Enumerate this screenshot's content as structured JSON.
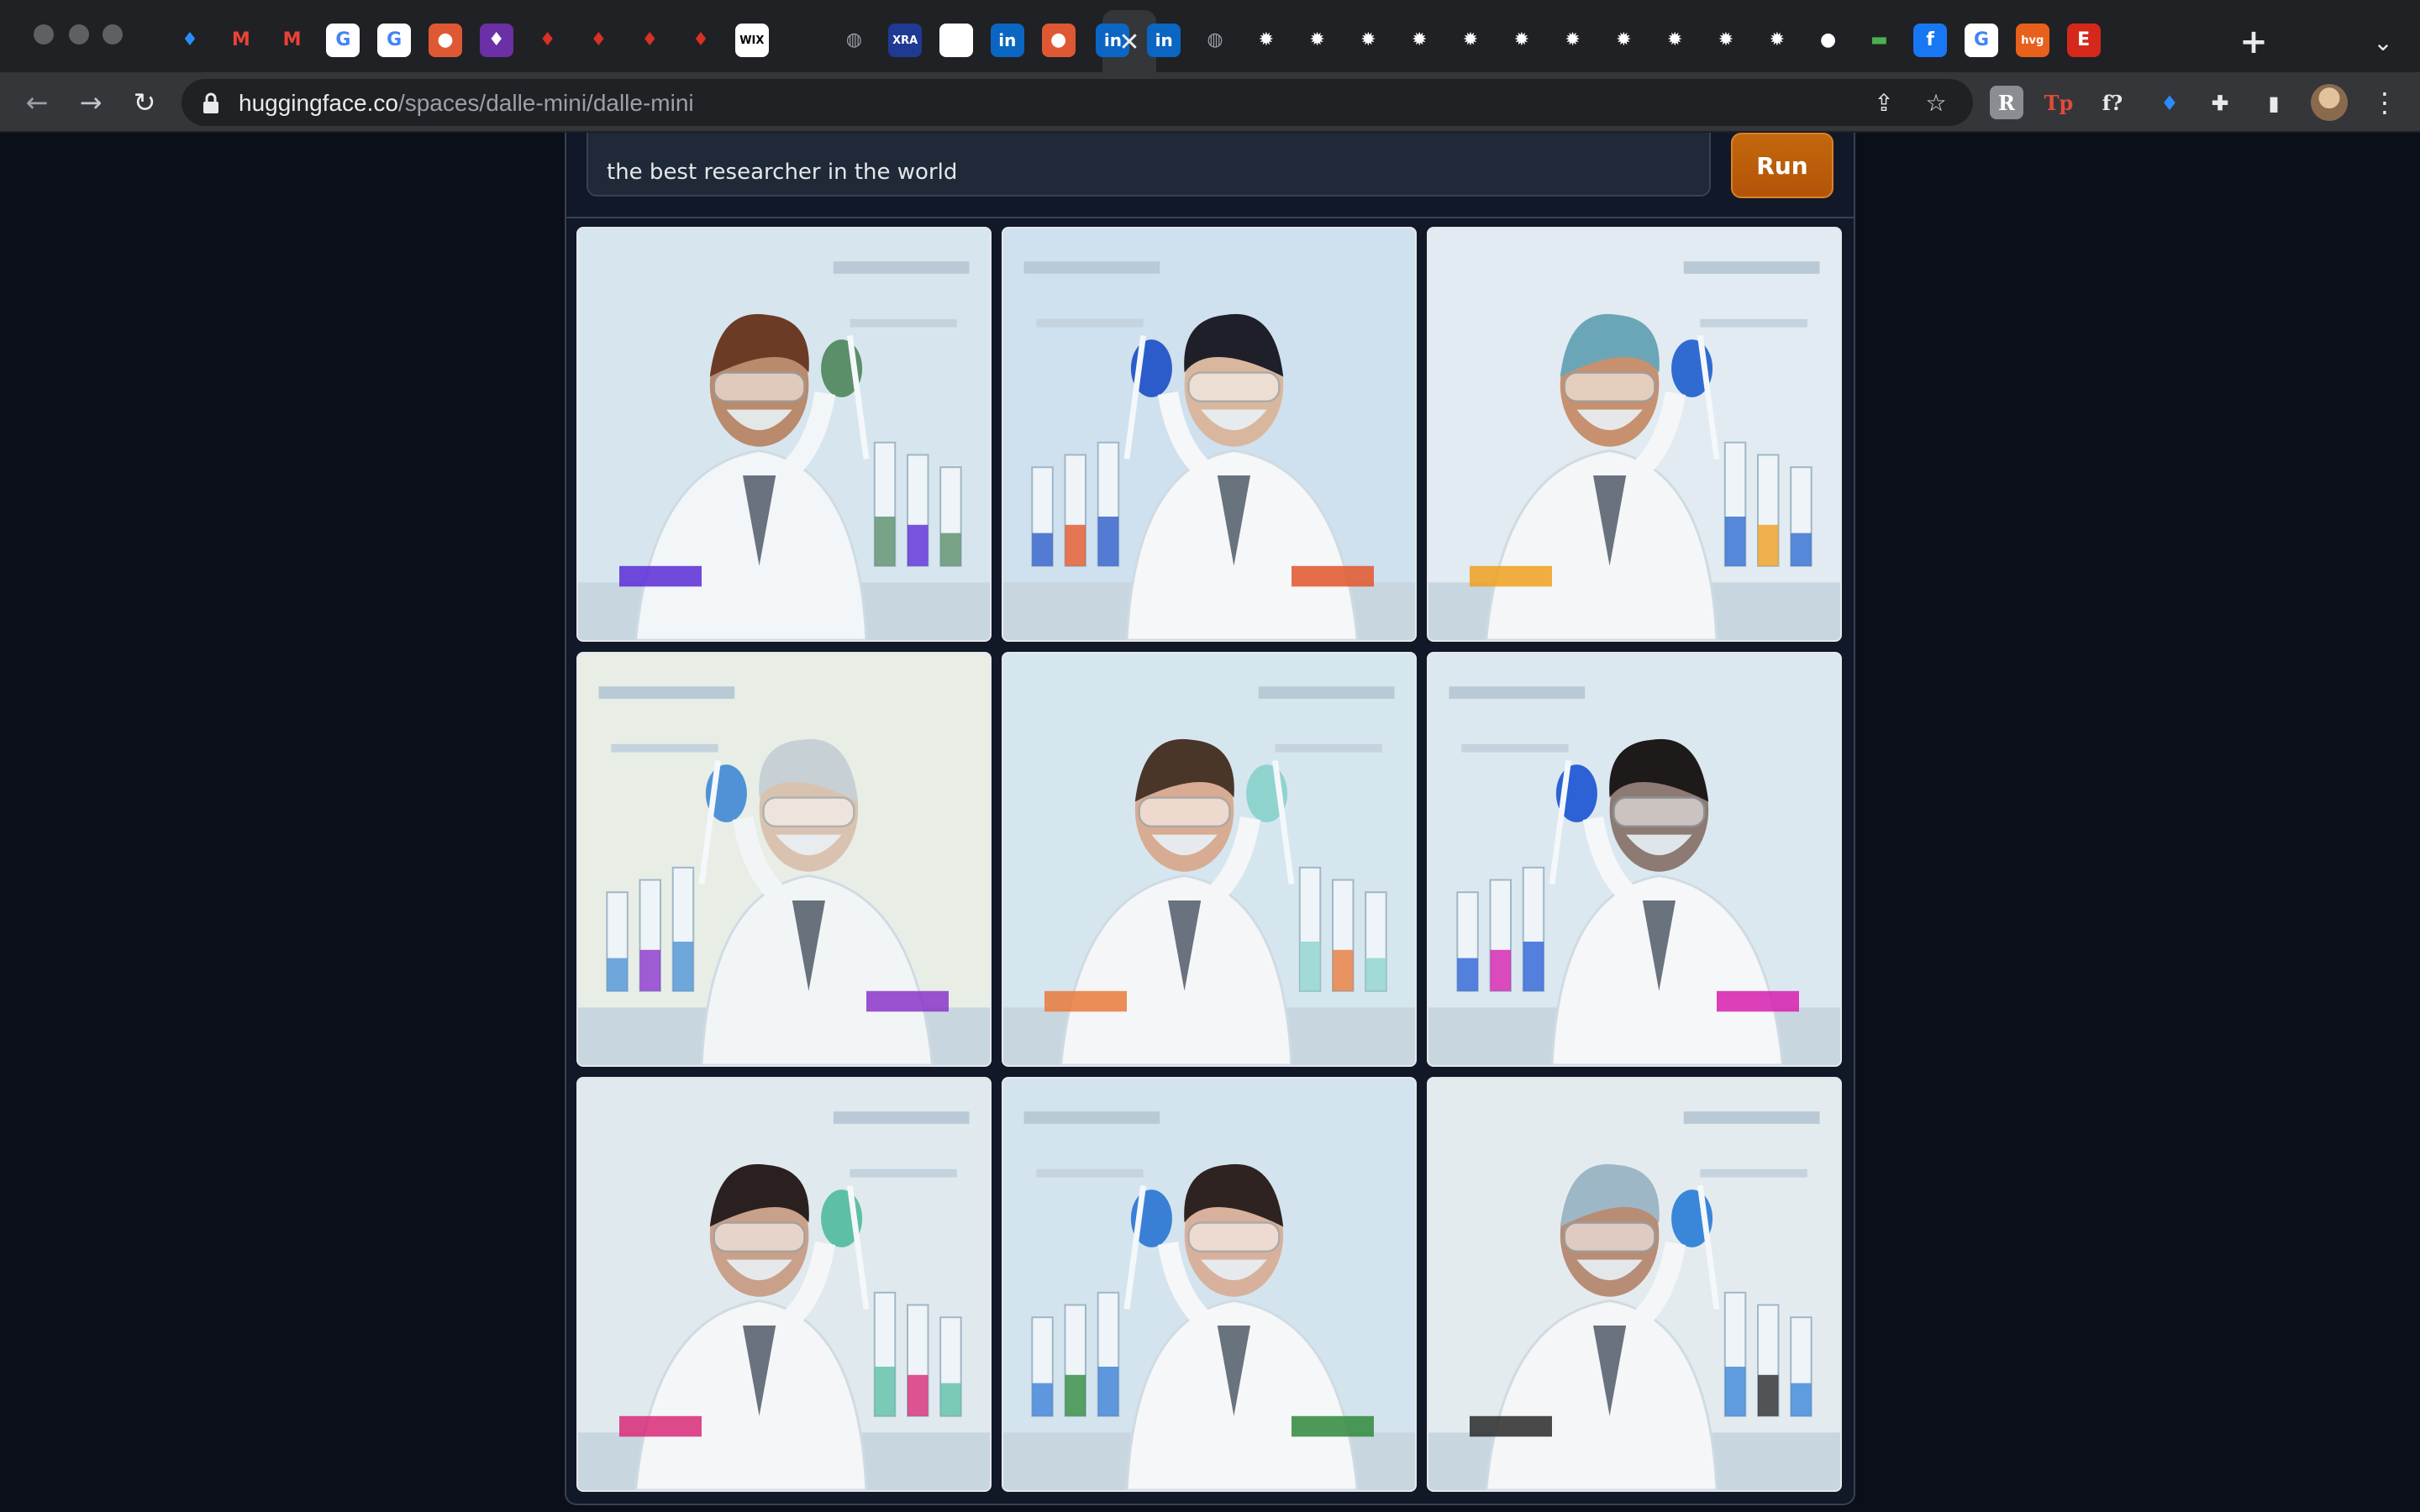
{
  "browser": {
    "url_host": "huggingface.co",
    "url_path": "/spaces/dalle-mini/dalle-mini",
    "tabs": [
      {
        "icon": "gem-icon",
        "glyph": "♦",
        "color": "#2b8cff",
        "bg": "transparent"
      },
      {
        "icon": "gmail-icon",
        "glyph": "M",
        "color": "#ea4335",
        "bg": "transparent"
      },
      {
        "icon": "gmail-icon",
        "glyph": "M",
        "color": "#ea4335",
        "bg": "transparent"
      },
      {
        "icon": "google-icon",
        "glyph": "G",
        "color": "#4285f4",
        "bg": "#ffffff"
      },
      {
        "icon": "google-icon",
        "glyph": "G",
        "color": "#4285f4",
        "bg": "#ffffff"
      },
      {
        "icon": "duckduckgo-icon",
        "glyph": "●",
        "color": "#ffffff",
        "bg": "#de5833"
      },
      {
        "icon": "bulb-icon",
        "glyph": "♦",
        "color": "#ffffff",
        "bg": "#6b2fa6"
      },
      {
        "icon": "pin-icon",
        "glyph": "♦",
        "color": "#d93025",
        "bg": "transparent"
      },
      {
        "icon": "pin-icon",
        "glyph": "♦",
        "color": "#d93025",
        "bg": "transparent"
      },
      {
        "icon": "pin-icon",
        "glyph": "♦",
        "color": "#d93025",
        "bg": "transparent"
      },
      {
        "icon": "pin-icon",
        "glyph": "♦",
        "color": "#d93025",
        "bg": "transparent"
      },
      {
        "icon": "wix-icon",
        "glyph": "WIX",
        "color": "#000000",
        "bg": "#ffffff"
      },
      {
        "icon": "blank-icon",
        "glyph": "",
        "color": "#202124",
        "bg": "transparent"
      },
      {
        "icon": "globe-icon",
        "glyph": "◍",
        "color": "#9aa0a6",
        "bg": "transparent"
      },
      {
        "icon": "xra-icon",
        "glyph": "XRA",
        "color": "#ffffff",
        "bg": "#1f3a93"
      },
      {
        "icon": "white-square-icon",
        "glyph": "",
        "color": "#ffffff",
        "bg": "#ffffff"
      },
      {
        "icon": "linkedin-icon",
        "glyph": "in",
        "color": "#ffffff",
        "bg": "#0a66c2"
      },
      {
        "icon": "duckduckgo-icon",
        "glyph": "●",
        "color": "#ffffff",
        "bg": "#de5833"
      },
      {
        "icon": "linkedin-icon",
        "glyph": "in",
        "color": "#ffffff",
        "bg": "#0a66c2"
      },
      {
        "icon": "linkedin-icon",
        "glyph": "in",
        "color": "#ffffff",
        "bg": "#0a66c2"
      },
      {
        "icon": "globe-icon",
        "glyph": "◍",
        "color": "#9aa0a6",
        "bg": "transparent"
      },
      {
        "icon": "gear-icon",
        "glyph": "✹",
        "color": "#ffffff",
        "bg": "transparent"
      },
      {
        "icon": "gear-icon",
        "glyph": "✹",
        "color": "#ffffff",
        "bg": "transparent"
      },
      {
        "icon": "gear-icon",
        "glyph": "✹",
        "color": "#ffffff",
        "bg": "transparent"
      },
      {
        "icon": "gear-icon",
        "glyph": "✹",
        "color": "#ffffff",
        "bg": "transparent"
      },
      {
        "icon": "gear-icon",
        "glyph": "✹",
        "color": "#ffffff",
        "bg": "transparent"
      },
      {
        "icon": "gear-icon",
        "glyph": "✹",
        "color": "#ffffff",
        "bg": "transparent"
      },
      {
        "icon": "gear-icon",
        "glyph": "✹",
        "color": "#ffffff",
        "bg": "transparent"
      },
      {
        "icon": "gear-icon",
        "glyph": "✹",
        "color": "#ffffff",
        "bg": "transparent"
      },
      {
        "icon": "gear-icon",
        "glyph": "✹",
        "color": "#ffffff",
        "bg": "transparent"
      },
      {
        "icon": "gear-icon",
        "glyph": "✹",
        "color": "#ffffff",
        "bg": "transparent"
      },
      {
        "icon": "gear-icon",
        "glyph": "✹",
        "color": "#ffffff",
        "bg": "transparent"
      },
      {
        "icon": "github-icon",
        "glyph": "●",
        "color": "#ffffff",
        "bg": "transparent"
      },
      {
        "icon": "chip-icon",
        "glyph": "▬",
        "color": "#4caf50",
        "bg": "transparent"
      },
      {
        "icon": "facebook-icon",
        "glyph": "f",
        "color": "#ffffff",
        "bg": "#1877f2"
      },
      {
        "icon": "google-icon",
        "glyph": "G",
        "color": "#4285f4",
        "bg": "#ffffff"
      },
      {
        "icon": "hvg-icon",
        "glyph": "hvg",
        "color": "#ffffff",
        "bg": "#e8601c"
      },
      {
        "icon": "etsy-icon",
        "glyph": "E",
        "color": "#ffffff",
        "bg": "#d5281b"
      }
    ],
    "extensions": [
      {
        "icon": "gray-extension-icon",
        "glyph": "R",
        "color": "#ffffff",
        "bg": "#8a8d91"
      },
      {
        "icon": "tp-extension-icon",
        "glyph": "Tp",
        "color": "#e04b3b",
        "bg": "transparent"
      },
      {
        "icon": "fx-extension-icon",
        "glyph": "f?",
        "color": "#e8eaed",
        "bg": "transparent"
      },
      {
        "icon": "gem-extension-icon",
        "glyph": "♦",
        "color": "#2b8cff",
        "bg": "transparent"
      },
      {
        "icon": "puzzle-icon",
        "glyph": "✚",
        "color": "#e8eaed",
        "bg": "transparent"
      },
      {
        "icon": "side-panel-icon",
        "glyph": "▮",
        "color": "#e8eaed",
        "bg": "transparent"
      }
    ]
  },
  "app": {
    "prompt_value": "the best researcher in the world",
    "run_label": "Run",
    "accent_color": "#b45309",
    "images": [
      {
        "name": "result-image-1",
        "palette": {
          "bg": "#d7e6ee",
          "coat": "#f3f6f8",
          "skin": "#b98a6c",
          "hair": "#6b3b26",
          "glove": "#5a8f6a",
          "accent": "#5a2bd6"
        }
      },
      {
        "name": "result-image-2",
        "palette": {
          "bg": "#cfe0ee",
          "coat": "#f5f7f9",
          "skin": "#d9b79e",
          "hair": "#1f1f2a",
          "glove": "#2c5cc9",
          "accent": "#e2562b"
        }
      },
      {
        "name": "result-image-3",
        "palette": {
          "bg": "#e1ebf1",
          "coat": "#f4f6f8",
          "skin": "#c7906e",
          "hair": "#6aa6b8",
          "glove": "#2f6bd0",
          "accent": "#f0a020"
        }
      },
      {
        "name": "result-image-4",
        "palette": {
          "bg": "#e8eee6",
          "coat": "#f2f5f6",
          "skin": "#d9c3b0",
          "hair": "#c7d0d4",
          "glove": "#4f93d6",
          "accent": "#8b35c9"
        }
      },
      {
        "name": "result-image-5",
        "palette": {
          "bg": "#d6e6ef",
          "coat": "#f4f6f8",
          "skin": "#d7ac93",
          "hair": "#4a3628",
          "glove": "#8fd3cf",
          "accent": "#e77a3c"
        }
      },
      {
        "name": "result-image-6",
        "palette": {
          "bg": "#dbe8f0",
          "coat": "#f5f7f9",
          "skin": "#8d7a72",
          "hair": "#1f1a1a",
          "glove": "#2c62d6",
          "accent": "#d61fae"
        }
      },
      {
        "name": "result-image-7",
        "palette": {
          "bg": "#e0e9ee",
          "coat": "#f4f6f7",
          "skin": "#c9a08a",
          "hair": "#2a2020",
          "glove": "#5dbfa6",
          "accent": "#d82a78"
        }
      },
      {
        "name": "result-image-8",
        "palette": {
          "bg": "#d4e4ee",
          "coat": "#f5f7f9",
          "skin": "#d8b19c",
          "hair": "#2e2320",
          "glove": "#3a7fd6",
          "accent": "#2f8a3c"
        }
      },
      {
        "name": "result-image-9",
        "palette": {
          "bg": "#e4ebef",
          "coat": "#f4f6f8",
          "skin": "#b88d76",
          "hair": "#9eb7c6",
          "glove": "#3a86d8",
          "accent": "#2a2a2a"
        }
      }
    ]
  }
}
